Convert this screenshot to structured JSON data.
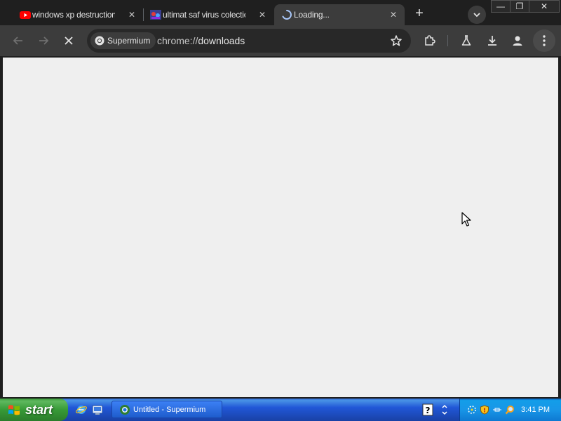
{
  "browser": {
    "tabs": [
      {
        "title": "windows xp destruction",
        "icon": "youtube-icon",
        "close_label": "✕"
      },
      {
        "title": "ultimat saf virus colection",
        "icon": "site-favicon-icon",
        "close_label": "✕"
      },
      {
        "title": "Loading...",
        "icon": "loading-spinner-icon",
        "close_label": "✕",
        "active": true
      }
    ],
    "new_tab_label": "+",
    "window_controls": {
      "minimize": "—",
      "restore": "❐",
      "close": "✕"
    },
    "toolbar": {
      "site_chip": "Supermium",
      "url_scheme": "chrome://",
      "url_path": "downloads"
    }
  },
  "taskbar": {
    "start_label": "start",
    "task_button": "Untitled - Supermium",
    "clock": "3:41 PM"
  },
  "colors": {
    "tabstrip": "#1f1f1f",
    "toolbar": "#3c3c3c",
    "content_bg": "#efefef",
    "taskbar_blue": "#2157d7",
    "start_green": "#379a37"
  }
}
